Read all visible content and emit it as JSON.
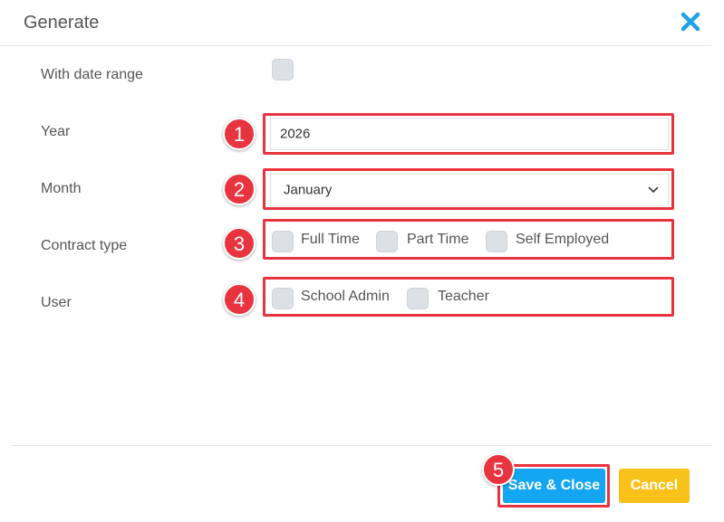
{
  "dialog": {
    "title": "Generate"
  },
  "form": {
    "date_range_label": "With date range",
    "year_label": "Year",
    "year_value": "2026",
    "month_label": "Month",
    "month_value": "January",
    "contract_label": "Contract type",
    "contract_options": [
      "Full Time",
      "Part Time",
      "Self Employed"
    ],
    "user_label": "User",
    "user_options": [
      "School Admin",
      "Teacher"
    ]
  },
  "footer": {
    "save_label": "Save & Close",
    "cancel_label": "Cancel"
  },
  "annotations": [
    "1",
    "2",
    "3",
    "4",
    "5"
  ],
  "colors": {
    "accent_close": "#1fa2e6",
    "save_button": "#14a6f0",
    "cancel_button": "#f8c21a",
    "highlight": "#e8343f"
  }
}
